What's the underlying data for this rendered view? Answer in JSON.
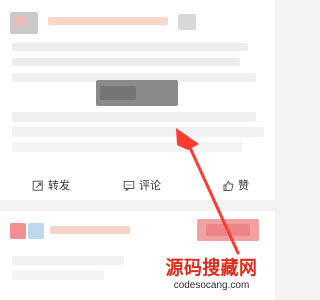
{
  "feed": {
    "post1": {
      "actions": {
        "repost": "转发",
        "comment": "评论",
        "like": "赞"
      }
    }
  },
  "watermark": {
    "title": "源码搜藏网",
    "subtitle": "codesocang.com"
  },
  "colors": {
    "accent_red": "#e12b1c",
    "background_gray": "#f3f3f3",
    "text_dark": "#333333"
  }
}
